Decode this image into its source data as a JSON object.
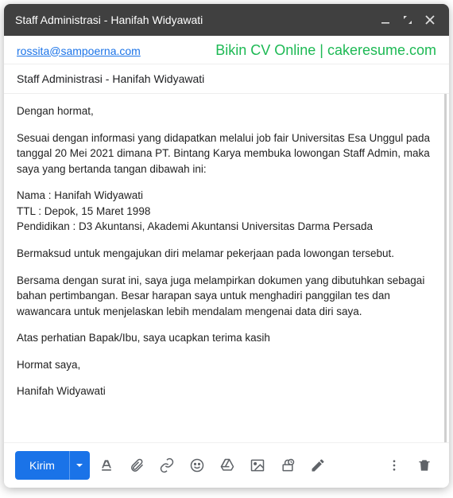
{
  "titlebar": {
    "title": "Staff Administrasi - Hanifah Widyawati"
  },
  "header": {
    "recipient": "rossita@sampoerna.com",
    "watermark": "Bikin CV Online | cakeresume.com"
  },
  "subject": "Staff Administrasi - Hanifah Widyawati",
  "body": {
    "greeting": "Dengan hormat,",
    "p1": "Sesuai dengan informasi yang didapatkan melalui job fair Universitas Esa Unggul pada tanggal 20 Mei 2021 dimana PT. Bintang Karya membuka lowongan Staff Admin, maka saya yang bertanda tangan dibawah ini:",
    "info1": "Nama : Hanifah Widyawati",
    "info2": "TTL : Depok, 15 Maret 1998",
    "info3": "Pendidikan : D3 Akuntansi, Akademi Akuntansi Universitas Darma Persada",
    "p2": "Bermaksud untuk mengajukan diri melamar pekerjaan pada lowongan tersebut.",
    "p3": "Bersama dengan surat ini, saya juga melampirkan dokumen yang dibutuhkan sebagai bahan pertimbangan. Besar harapan saya untuk menghadiri panggilan tes dan wawancara untuk menjelaskan lebih mendalam mengenai data diri saya.",
    "p4": "Atas perhatian Bapak/Ibu, saya ucapkan terima kasih",
    "closing": "Hormat saya,",
    "signature": "Hanifah Widyawati"
  },
  "toolbar": {
    "send_label": "Kirim"
  }
}
